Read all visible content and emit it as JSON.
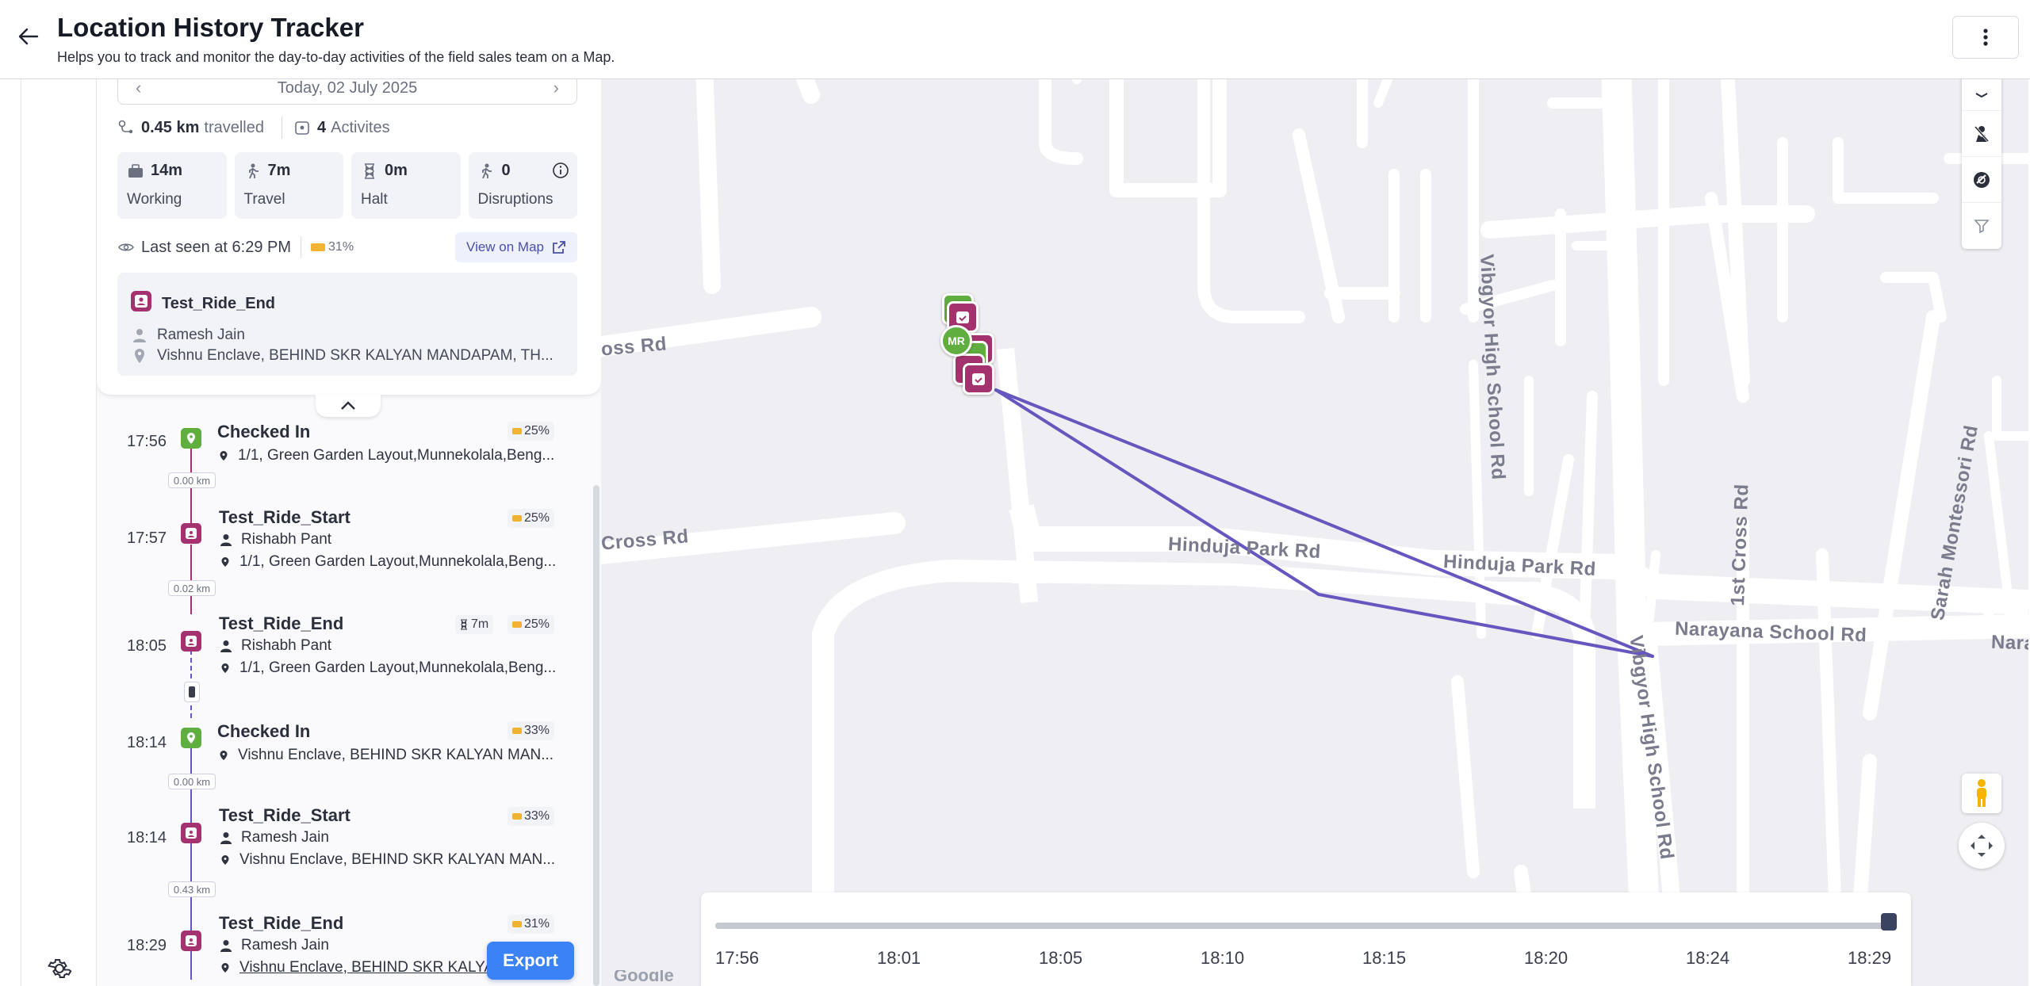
{
  "header": {
    "title": "Location History Tracker",
    "subtitle": "Helps you to track and monitor the day-to-day activities of the field sales team on a Map."
  },
  "summary": {
    "date_label": "Today, 02 July 2025",
    "distance_value": "0.45 km",
    "distance_label": "travelled",
    "activities_value": "4",
    "activities_label": "Activites",
    "tiles": [
      {
        "value": "14m",
        "label": "Working",
        "icon": "briefcase-icon"
      },
      {
        "value": "7m",
        "label": "Travel",
        "icon": "walking-icon"
      },
      {
        "value": "0m",
        "label": "Halt",
        "icon": "hourglass-icon"
      },
      {
        "value": "0",
        "label": "Disruptions",
        "icon": "disruption-icon"
      }
    ],
    "last_seen": "Last seen at 6:29 PM",
    "battery": "31%",
    "view_on_map": "View on Map",
    "activity": {
      "name": "Test_Ride_End",
      "person": "Ramesh Jain",
      "address": "Vishnu Enclave, BEHIND SKR KALYAN MANDAPAM, TH..."
    }
  },
  "timeline": [
    {
      "time": "17:56",
      "title": "Checked In",
      "type": "checkin",
      "person": "",
      "address": "1/1, Green Garden Layout,Munnekolala,Beng...",
      "battery": "25%",
      "halt": "",
      "distance_after": "0.00 km"
    },
    {
      "time": "17:57",
      "title": "Test_Ride_Start",
      "type": "ride",
      "person": "Rishabh Pant",
      "address": "1/1, Green Garden Layout,Munnekolala,Beng...",
      "battery": "25%",
      "halt": "",
      "distance_after": "0.02 km"
    },
    {
      "time": "18:05",
      "title": "Test_Ride_End",
      "type": "ride",
      "person": "Rishabh Pant",
      "address": "1/1, Green Garden Layout,Munnekolala,Beng...",
      "battery": "25%",
      "halt": "7m",
      "distance_after": ""
    },
    {
      "time": "18:14",
      "title": "Checked In",
      "type": "checkin",
      "person": "",
      "address": "Vishnu Enclave, BEHIND SKR KALYAN MAN...",
      "battery": "33%",
      "halt": "",
      "distance_after": "0.00 km"
    },
    {
      "time": "18:14",
      "title": "Test_Ride_Start",
      "type": "ride",
      "person": "Ramesh Jain",
      "address": "Vishnu Enclave, BEHIND SKR KALYAN MAN...",
      "battery": "33%",
      "halt": "",
      "distance_after": "0.43 km"
    },
    {
      "time": "18:29",
      "title": "Test_Ride_End",
      "type": "ride",
      "person": "Ramesh Jain",
      "address": "Vishnu Enclave, BEHIND SKR KALYA",
      "battery": "31%",
      "halt": "",
      "distance_after": ""
    }
  ],
  "export_label": "Export",
  "map": {
    "streets": [
      "Vibgyor High School Rd",
      "Hinduja Park Rd",
      "Hinduja Park Rd",
      "Narayana School Rd",
      "Naray",
      "1st Cross Rd",
      "Sarah Montessori Rd",
      "Vibgyor High School Rd",
      "Cross Rd",
      "oss Rd"
    ],
    "marker_initials": "MR",
    "route_color": "#6557bf",
    "timeline_ticks": [
      "17:56",
      "18:01",
      "18:05",
      "18:10",
      "18:15",
      "18:20",
      "18:24",
      "18:29"
    ],
    "slider_position": 1.0,
    "google": "Google"
  },
  "colors": {
    "checkin_green": "#5fae3f",
    "ride_magenta": "#a4326f",
    "route": "#6557bf",
    "accent_blue": "#3b82f6"
  }
}
